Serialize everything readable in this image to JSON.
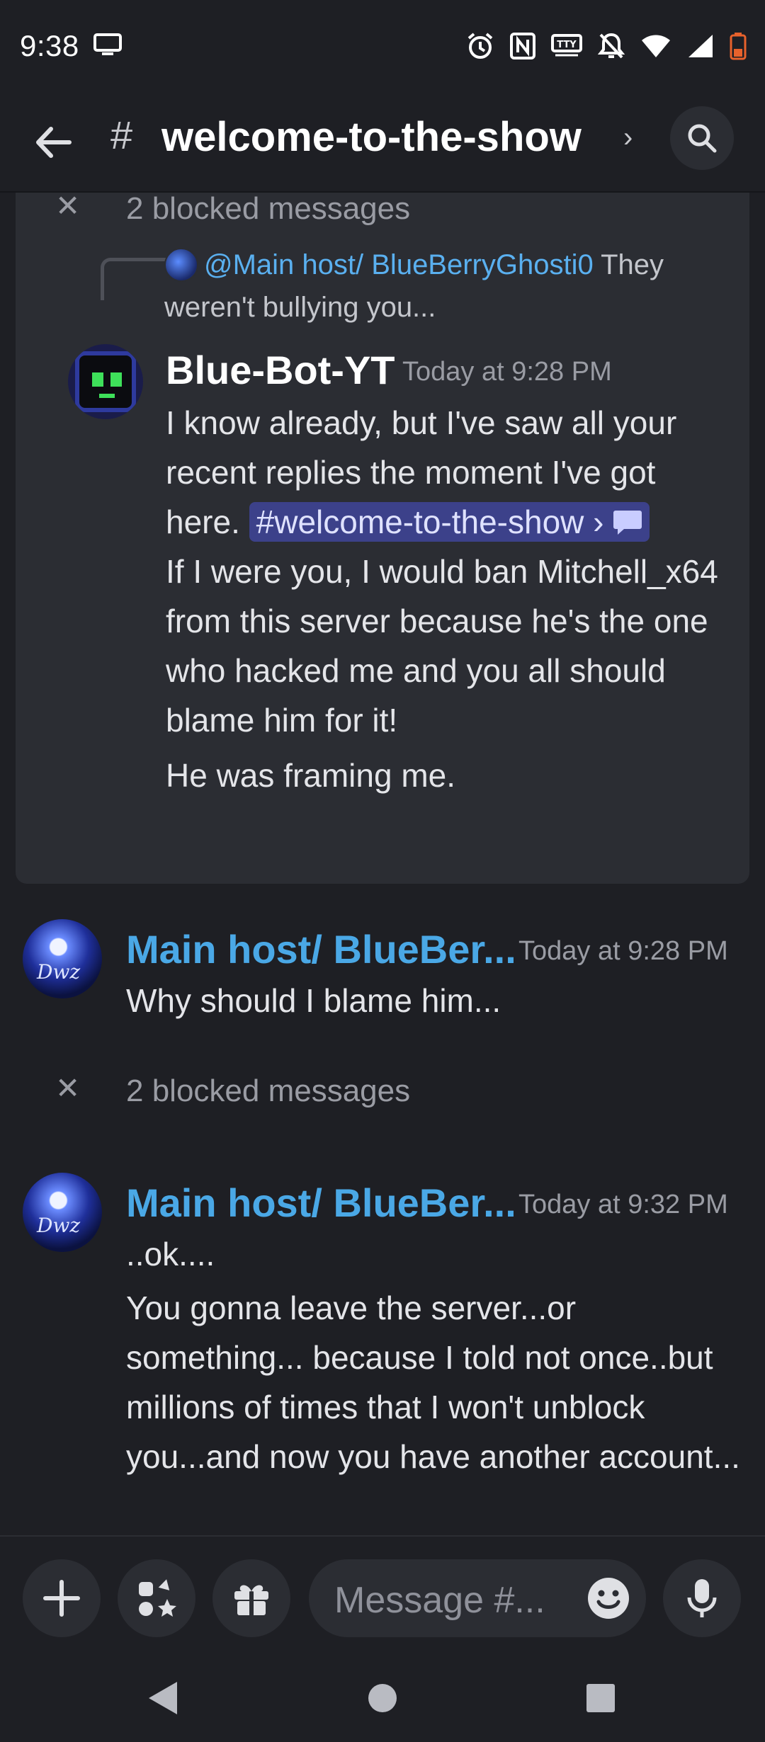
{
  "status_bar": {
    "time": "9:38"
  },
  "header": {
    "back_icon": "arrow-left-icon",
    "channel_prefix": "#",
    "channel_name": "welcome-to-the-show",
    "chevron": "›",
    "search_icon": "search-icon"
  },
  "blocked_top": {
    "label": "2 blocked messages"
  },
  "reply": {
    "mention": "@Main host/ BlueBerryGhosti0",
    "text": " They weren't bullying you..."
  },
  "bot_message": {
    "author": "Blue-Bot-YT",
    "author_color": "#ffffff",
    "time": "Today at 9:28 PM",
    "line1": "I know already, but I've saw all your recent replies the moment I've got here. ",
    "channel_pill": "#welcome-to-the-show",
    "pill_chevron": " › ",
    "line2": "If I were you, I would ban Mitchell_x64 from this server because he's the one who hacked me and you all should blame him for it!",
    "line3": "He was framing me."
  },
  "message2": {
    "author": "Main host/ BlueBer...",
    "author_color": "#4aa8e6",
    "time": "Today at 9:28 PM",
    "text": "Why should I blame him..."
  },
  "blocked_mid": {
    "label": "2 blocked messages"
  },
  "message3": {
    "author": "Main host/ BlueBer...",
    "time": "Today at 9:32 PM",
    "line1": "..ok....",
    "line2": "You gonna leave the server...or something... because I told not once..but millions of times that I won't unblock you...and now you have another account..."
  },
  "composer": {
    "placeholder": "Message #..."
  }
}
